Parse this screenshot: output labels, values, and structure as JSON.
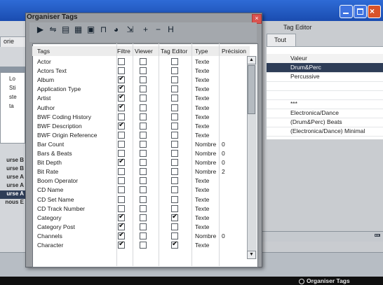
{
  "dialog": {
    "title": "Organiser Tags",
    "close_glyph": "×",
    "toolbar": [
      {
        "icon": "play-icon",
        "glyph": "▶"
      },
      {
        "icon": "filter-icon",
        "glyph": "⇋"
      },
      {
        "icon": "list-view-icon",
        "glyph": "▤"
      },
      {
        "icon": "table-view-icon",
        "glyph": "▦"
      },
      {
        "icon": "save-icon",
        "glyph": "▣"
      },
      {
        "icon": "column-icon",
        "glyph": "⊓"
      },
      {
        "icon": "globe-icon",
        "glyph": "◕"
      },
      {
        "icon": "import-icon",
        "glyph": "⇲"
      },
      {
        "icon": "add-icon",
        "glyph": "+"
      },
      {
        "icon": "remove-icon",
        "glyph": "−"
      },
      {
        "icon": "rename-icon",
        "glyph": "H"
      }
    ],
    "headers": {
      "tags": "Tags",
      "filtre": "Filtre",
      "viewer": "Viewer",
      "tag_editor": "Tag Editor",
      "type": "Type",
      "precision": "Précision"
    },
    "rows": [
      {
        "name": "Actor",
        "filtre": false,
        "viewer": false,
        "editor": false,
        "type": "Texte",
        "precision": ""
      },
      {
        "name": "Actors Text",
        "filtre": false,
        "viewer": false,
        "editor": false,
        "type": "Texte",
        "precision": ""
      },
      {
        "name": "Album",
        "filtre": true,
        "viewer": false,
        "editor": false,
        "type": "Texte",
        "precision": ""
      },
      {
        "name": "Application Type",
        "filtre": true,
        "viewer": false,
        "editor": false,
        "type": "Texte",
        "precision": ""
      },
      {
        "name": "Artist",
        "filtre": true,
        "viewer": false,
        "editor": false,
        "type": "Texte",
        "precision": ""
      },
      {
        "name": "Author",
        "filtre": true,
        "viewer": false,
        "editor": false,
        "type": "Texte",
        "precision": ""
      },
      {
        "name": "BWF Coding History",
        "filtre": false,
        "viewer": false,
        "editor": false,
        "type": "Texte",
        "precision": ""
      },
      {
        "name": "BWF Description",
        "filtre": true,
        "viewer": false,
        "editor": false,
        "type": "Texte",
        "precision": ""
      },
      {
        "name": "BWF Origin Reference",
        "filtre": false,
        "viewer": false,
        "editor": false,
        "type": "Texte",
        "precision": ""
      },
      {
        "name": "Bar Count",
        "filtre": false,
        "viewer": false,
        "editor": false,
        "type": "Nombre",
        "precision": "0"
      },
      {
        "name": "Bars & Beats",
        "filtre": false,
        "viewer": false,
        "editor": false,
        "type": "Nombre",
        "precision": "0"
      },
      {
        "name": "Bit Depth",
        "filtre": true,
        "viewer": false,
        "editor": false,
        "type": "Nombre",
        "precision": "0"
      },
      {
        "name": "Bit Rate",
        "filtre": false,
        "viewer": false,
        "editor": false,
        "type": "Nombre",
        "precision": "2"
      },
      {
        "name": "Boom Operator",
        "filtre": false,
        "viewer": false,
        "editor": false,
        "type": "Texte",
        "precision": ""
      },
      {
        "name": "CD Name",
        "filtre": false,
        "viewer": false,
        "editor": false,
        "type": "Texte",
        "precision": ""
      },
      {
        "name": "CD Set Name",
        "filtre": false,
        "viewer": false,
        "editor": false,
        "type": "Texte",
        "precision": ""
      },
      {
        "name": "CD Track Number",
        "filtre": false,
        "viewer": false,
        "editor": false,
        "type": "Texte",
        "precision": ""
      },
      {
        "name": "Category",
        "filtre": true,
        "viewer": false,
        "editor": true,
        "type": "Texte",
        "precision": ""
      },
      {
        "name": "Category Post",
        "filtre": true,
        "viewer": false,
        "editor": false,
        "type": "Texte",
        "precision": ""
      },
      {
        "name": "Channels",
        "filtre": true,
        "viewer": false,
        "editor": false,
        "type": "Nombre",
        "precision": "0"
      },
      {
        "name": "Character",
        "filtre": true,
        "viewer": false,
        "editor": true,
        "type": "Texte",
        "precision": ""
      }
    ]
  },
  "left_panel": {
    "tab_label": "orie",
    "list_items": [
      "Lo",
      "Sti",
      "ste",
      "ta"
    ],
    "labels": [
      "urse B",
      "urse B",
      "urse A",
      "urse A",
      "urse A",
      "nous E"
    ],
    "selected_label_index": 4
  },
  "tag_editor": {
    "title": "Tag Editor",
    "tab_label": "Tout",
    "values": [
      {
        "text": "Valeur",
        "header": true
      },
      {
        "text": "Drum&Perc",
        "selected": true
      },
      {
        "text": "Percussive"
      },
      {
        "text": ""
      },
      {
        "text": ""
      },
      {
        "text": "***"
      },
      {
        "text": "Electronica/Dance"
      },
      {
        "text": "(Drum&Perc) Beats"
      },
      {
        "text": "(Electronica/Dance) Minimal"
      }
    ]
  },
  "status_bar": {
    "label": "Organiser Tags"
  },
  "window_controls": {
    "minimize": "minimize-icon",
    "maximize": "maximize-icon",
    "close": "×"
  }
}
